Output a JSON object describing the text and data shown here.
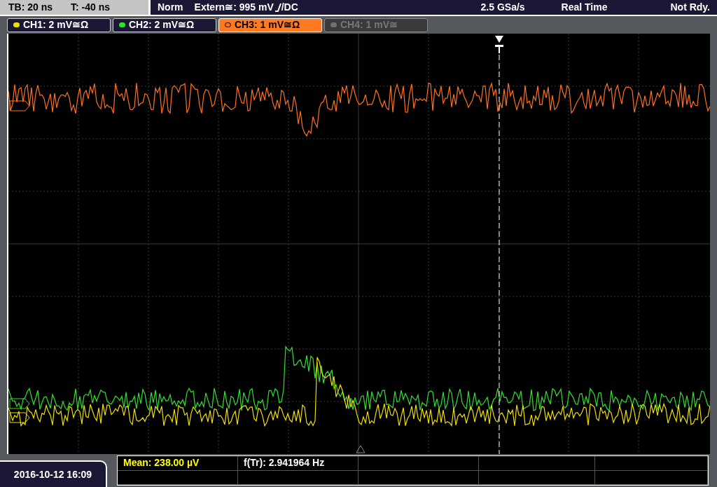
{
  "top_bar": {
    "timebase": "TB: 20 ns",
    "trigger_offset": "T: -40 ns",
    "trigger_mode": "Norm",
    "trigger_source": "Extern≅: 995 mV",
    "coupling": "/DC",
    "sample_rate": "2.5 GSa/s",
    "acquisition": "Real Time",
    "status": "Not Rdy."
  },
  "channels": [
    {
      "label": "CH1: 2 mV≅Ω",
      "color": "#f0e000",
      "selected": false,
      "enabled": true
    },
    {
      "label": "CH2: 2 mV≅Ω",
      "color": "#30e030",
      "selected": false,
      "enabled": true
    },
    {
      "label": "CH3: 1 mV≅Ω",
      "color": "#ff7020",
      "selected": true,
      "enabled": true
    },
    {
      "label": "CH4: 1 mV≅",
      "color": "#707070",
      "selected": false,
      "enabled": false
    }
  ],
  "date": "2016-10-12 16:09",
  "measurements": [
    {
      "text": "Mean: 238.00 µV",
      "color": "#ffff00"
    },
    {
      "text": "f(Tr): 2.941964 Hz",
      "color": "#ffffff"
    }
  ]
}
